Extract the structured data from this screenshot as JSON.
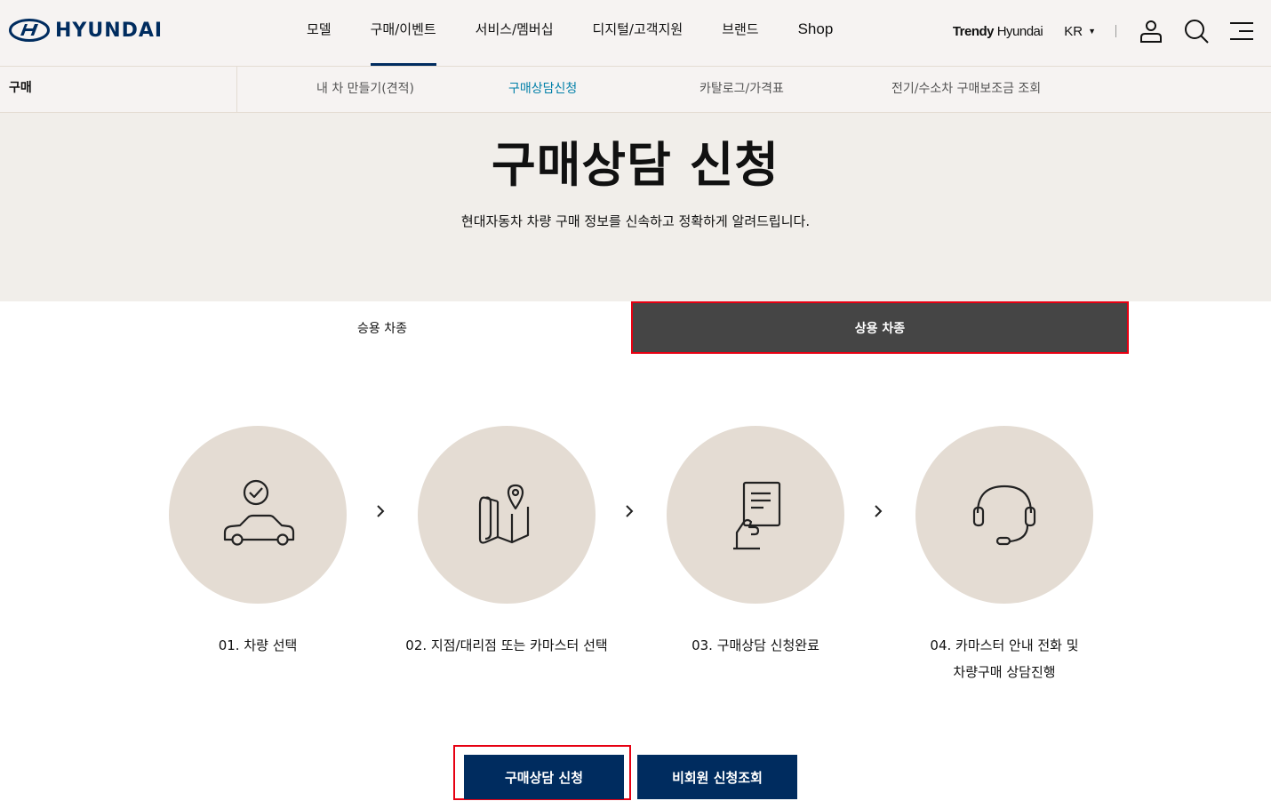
{
  "header": {
    "logo_text": "HYUNDAI",
    "menu": [
      "모델",
      "구매/이벤트",
      "서비스/멤버십",
      "디지털/고객지원",
      "브랜드",
      "Shop"
    ],
    "trendy_bold": "Trendy",
    "trendy_rest": " Hyundai",
    "lang": "KR"
  },
  "lnb": {
    "title": "구매",
    "items": [
      "내 차 만들기(견적)",
      "구매상담신청",
      "카탈로그/가격표",
      "전기/수소차 구매보조금 조회"
    ]
  },
  "hero": {
    "title": "구매상담 신청",
    "subtitle": "현대자동차 차량 구매 정보를 신속하고 정확하게 알려드립니다."
  },
  "tabs": {
    "passenger": "승용 차종",
    "commercial": "상용 차종"
  },
  "steps": [
    {
      "line1": "01. 차량 선택",
      "line2": "",
      "icon": "car-check-icon"
    },
    {
      "line1": "02. 지점/대리점 또는 카마스터 선택",
      "line2": "",
      "icon": "map-pin-icon"
    },
    {
      "line1": "03. 구매상담 신청완료",
      "line2": "",
      "icon": "document-hand-icon"
    },
    {
      "line1": "04. 카마스터 안내 전화 및",
      "line2": "차량구매 상담진행",
      "icon": "headset-icon"
    }
  ],
  "buttons": {
    "consult": "구매상담 신청",
    "lookup": "비회원 신청조회"
  },
  "colors": {
    "brand_navy": "#002c5f",
    "active_link": "#007fa8",
    "step_circle": "#e4dcd3",
    "hero_bg": "#f1eeea",
    "highlight_red": "#e60012"
  }
}
